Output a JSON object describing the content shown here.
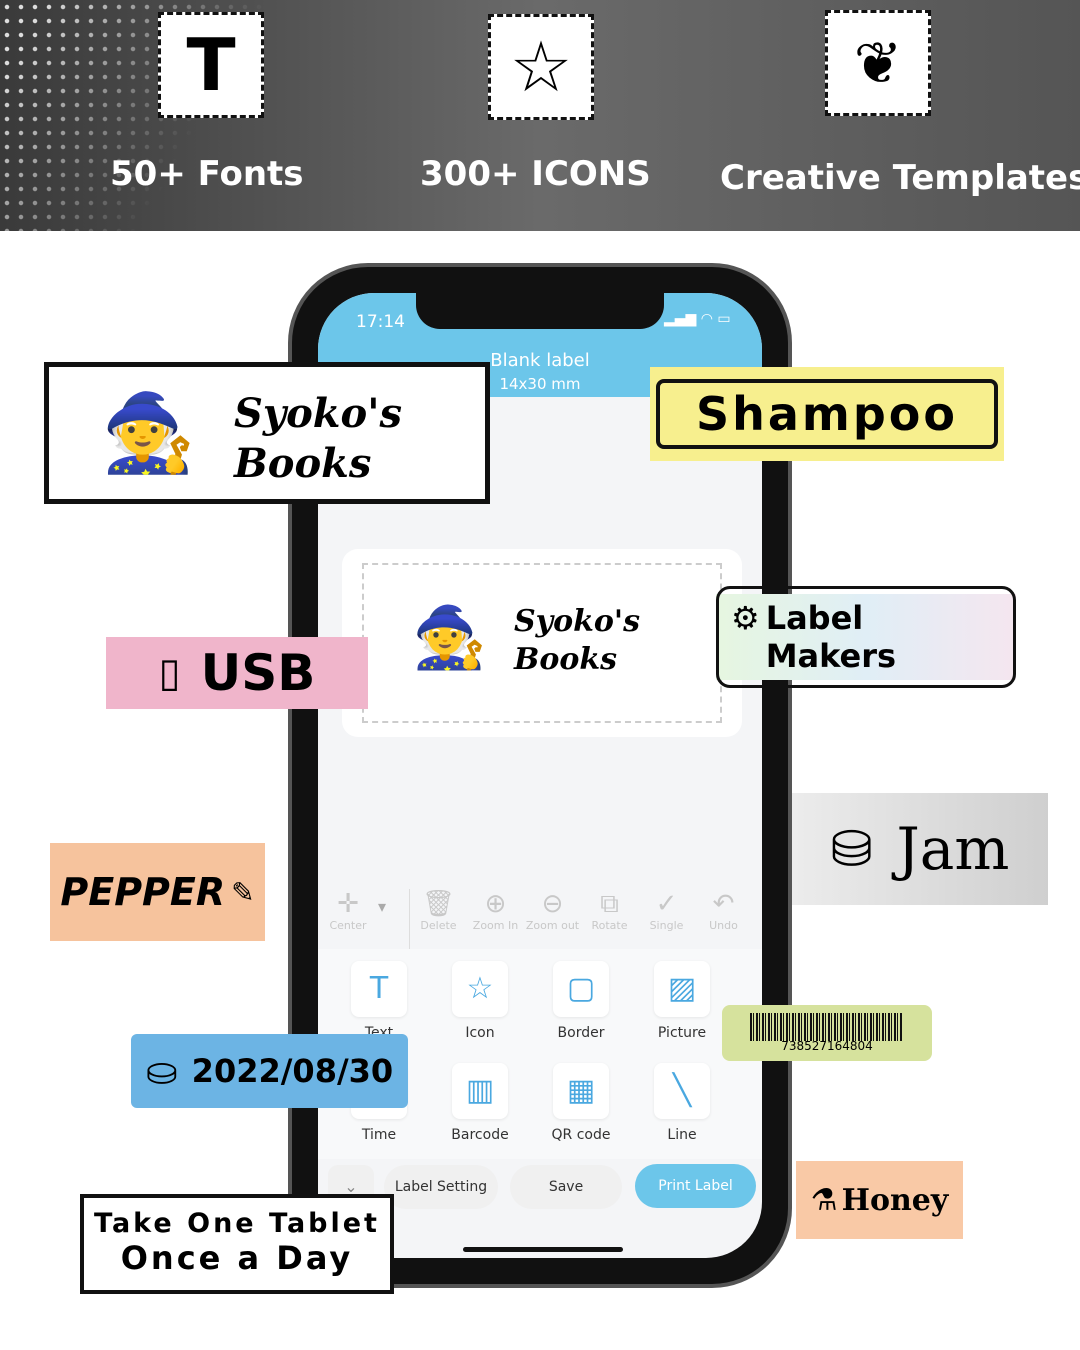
{
  "banner": {
    "features": [
      {
        "icon": "text-T-icon",
        "glyph": "T",
        "label": "50+ Fonts"
      },
      {
        "icon": "star-icon",
        "glyph": "☆",
        "label": "300+ ICONS"
      },
      {
        "icon": "leaf-icon",
        "glyph": "❦",
        "label": "Creative Templates"
      }
    ]
  },
  "phone": {
    "time": "17:14",
    "title": "Blank label",
    "size": "14x30 mm",
    "canvas_label": {
      "line1": "Syoko's",
      "line2": "Books"
    },
    "toolbar": [
      {
        "icon": "center-icon",
        "glyph": "✛",
        "label": "Center"
      },
      {
        "icon": "trash-icon",
        "glyph": "🗑",
        "label": "Delete"
      },
      {
        "icon": "zoom-in-icon",
        "glyph": "⊕",
        "label": "Zoom In"
      },
      {
        "icon": "zoom-out-icon",
        "glyph": "⊖",
        "label": "Zoom out"
      },
      {
        "icon": "rotate-icon",
        "glyph": "⧉",
        "label": "Rotate"
      },
      {
        "icon": "check-icon",
        "glyph": "✓",
        "label": "Single"
      },
      {
        "icon": "undo-icon",
        "glyph": "↶",
        "label": "Undo"
      }
    ],
    "items": [
      {
        "icon": "text-icon",
        "glyph": "T",
        "label": "Text"
      },
      {
        "icon": "star-icon",
        "glyph": "☆",
        "label": "Icon"
      },
      {
        "icon": "border-icon",
        "glyph": "▢",
        "label": "Border"
      },
      {
        "icon": "picture-icon",
        "glyph": "▨",
        "label": "Picture"
      },
      {
        "icon": "clock-icon",
        "glyph": "◷",
        "label": "Time"
      },
      {
        "icon": "barcode-icon",
        "glyph": "▥",
        "label": "Barcode"
      },
      {
        "icon": "qr-icon",
        "glyph": "▦",
        "label": "QR code"
      },
      {
        "icon": "line-icon",
        "glyph": "╲",
        "label": "Line"
      }
    ],
    "bottom": {
      "label_setting": "Label Setting",
      "save": "Save",
      "print": "Print Label"
    }
  },
  "labels": {
    "books": {
      "line1": "Syoko's",
      "line2": "Books"
    },
    "shampoo": "Shampoo",
    "usb": "USB",
    "label_makers": "Label Makers",
    "jam": "Jam",
    "pepper": "PEPPER",
    "barcode": "738527164804",
    "date": "2022/08/30",
    "honey": "Honey",
    "tablet": {
      "line1": "Take One Tablet",
      "line2": "Once a Day"
    }
  },
  "colors": {
    "accent": "#6cc6ea",
    "shampoo": "#f7ef8e",
    "usb": "#f0b5cb",
    "pepper": "#f6c39d",
    "barcode": "#d6e29d",
    "date": "#6cb4e4",
    "honey": "#f9c9a6",
    "jam": "#d8d8d8"
  }
}
